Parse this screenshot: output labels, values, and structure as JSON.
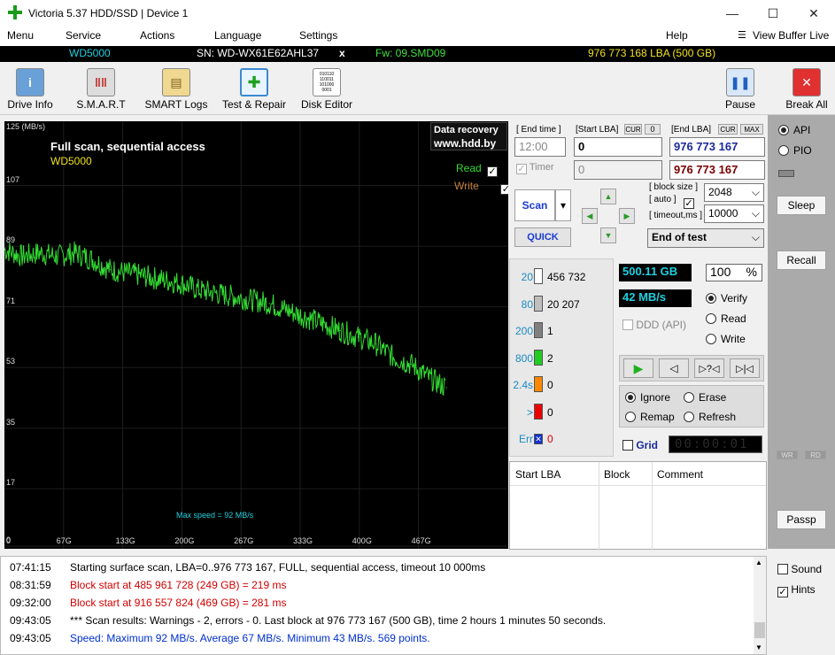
{
  "title": {
    "app": "Victoria 5.37 HDD/SSD | Device 1"
  },
  "menu": [
    "Menu",
    "Service",
    "Actions",
    "Language",
    "Settings",
    "Help",
    "View Buffer Live"
  ],
  "infobar": {
    "model": "WD5000",
    "sn": "SN: WD-WX61E62AHL37",
    "close": "x",
    "fw": "Fw: 09.SMD09",
    "lba": "976 773 168 LBA (500 GB)"
  },
  "toolbar": {
    "drive_info": "Drive Info",
    "smart": "S.M.A.R.T",
    "smart_logs": "SMART Logs",
    "test_repair": "Test & Repair",
    "disk_editor": "Disk Editor",
    "pause": "Pause",
    "break_all": "Break All",
    "disk_editor_icon_text": "010110 110011 101000 0001"
  },
  "graph": {
    "title": "Full scan, sequential access",
    "model": "WD5000",
    "ylabel": "125 (MB/s)",
    "y_ticks": [
      "107",
      "89",
      "71",
      "53",
      "35",
      "17",
      "0"
    ],
    "x_ticks": [
      "67G",
      "133G",
      "200G",
      "267G",
      "333G",
      "400G",
      "467G"
    ],
    "logo1": "Data recovery",
    "logo2": "www.hdd.by",
    "read": "Read",
    "write": "Write",
    "max_speed": "Max speed = 92 MB/s",
    "colors": {
      "line": "#33dd33",
      "read": "#33dd33",
      "write": "#c08040"
    }
  },
  "chart_data": {
    "type": "line",
    "ylabel": "125 (MB/s)",
    "ylim": [
      0,
      125
    ],
    "x_ticks": [
      "67G",
      "133G",
      "200G",
      "267G",
      "333G",
      "400G",
      "467G"
    ],
    "series": [
      {
        "name": "Read",
        "x": [
          0,
          20,
          40,
          60,
          80,
          100,
          120,
          140,
          160,
          180,
          200,
          220,
          240,
          260,
          280,
          300,
          320,
          340,
          360,
          380,
          400,
          420,
          440,
          460,
          480,
          500
        ],
        "values": [
          88,
          86,
          87,
          86,
          87,
          85,
          82,
          81,
          80,
          79,
          78,
          76,
          75,
          74,
          73,
          72,
          70,
          68,
          66,
          64,
          62,
          60,
          56,
          54,
          50,
          47
        ]
      }
    ]
  },
  "controls": {
    "end_time_label": "[ End time ]",
    "start_lba_label": "[Start LBA]",
    "cur1": "CUR",
    "zero": "0",
    "end_lba_label": "[End LBA]",
    "cur2": "CUR",
    "max": "MAX",
    "end_time": "12:00",
    "start_lba": "0",
    "end_lba": "976 773 167",
    "timer_label": "Timer",
    "timer_val": "0",
    "end_lba2": "976 773 167",
    "scan": "Scan",
    "quick": "QUICK",
    "block_size_label": "[ block size ]",
    "auto_label": "[ auto ]",
    "timeout_label": "[ timeout,ms ]",
    "block_size": "2048",
    "timeout": "10000",
    "end_of_test": "End of test",
    "size": "500.11 GB",
    "percent": "100",
    "pct_sign": "%",
    "speed": "42 MB/s",
    "ddd": "DDD (API)",
    "verify": "Verify",
    "read": "Read",
    "write": "Write",
    "ignore": "Ignore",
    "erase": "Erase",
    "remap": "Remap",
    "refresh": "Refresh",
    "grid": "Grid",
    "timer_display": "00:00:01",
    "blocks": [
      {
        "t": "20",
        "v": "456 732",
        "c": "#ffffff"
      },
      {
        "t": "80",
        "v": "20 207",
        "c": "#bfbfbf"
      },
      {
        "t": "200",
        "v": "1",
        "c": "#808080"
      },
      {
        "t": "800",
        "v": "2",
        "c": "#22cc22"
      },
      {
        "t": "2.4s",
        "v": "0",
        "c": "#ff8800"
      },
      {
        "t": ">",
        "v": "0",
        "c": "#ee0000"
      },
      {
        "t": "Err",
        "v": "0",
        "c": "#1030d0"
      }
    ],
    "tbl": {
      "c1": "Start LBA",
      "c2": "Block",
      "c3": "Comment"
    }
  },
  "right": {
    "api": "API",
    "pio": "PIO",
    "sleep": "Sleep",
    "recall": "Recall",
    "wr": "WR",
    "rd": "RD",
    "passp": "Passp",
    "sound": "Sound",
    "hints": "Hints"
  },
  "log": [
    {
      "t": "07:41:15",
      "m": "Starting surface scan, LBA=0..976 773 167, FULL, sequential access, timeout 10 000ms",
      "c": "#000"
    },
    {
      "t": "08:31:59",
      "m": "Block start at 485 961 728 (249 GB)  = 219 ms",
      "c": "#d00000"
    },
    {
      "t": "09:32:00",
      "m": "Block start at 916 557 824 (469 GB)  = 281 ms",
      "c": "#d00000"
    },
    {
      "t": "09:43:05",
      "m": "*** Scan results: Warnings - 2, errors - 0. Last block at 976 773 167 (500 GB), time 2 hours 1 minutes 50 seconds.",
      "c": "#000"
    },
    {
      "t": "09:43:05",
      "m": "Speed: Maximum 92 MB/s. Average 67 MB/s. Minimum 43 MB/s. 569 points.",
      "c": "#0030d0"
    }
  ]
}
